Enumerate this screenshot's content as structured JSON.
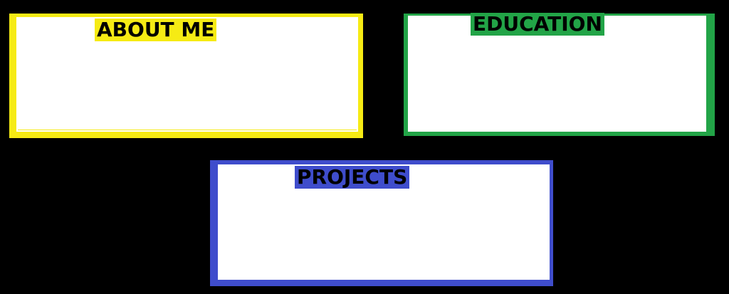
{
  "sections": {
    "about": {
      "title": "ABOUT ME",
      "color": "#f6eb14"
    },
    "education": {
      "title": "EDUCATION",
      "color": "#22a447"
    },
    "projects": {
      "title": "PROJECTS",
      "color": "#3f4dcc"
    }
  }
}
